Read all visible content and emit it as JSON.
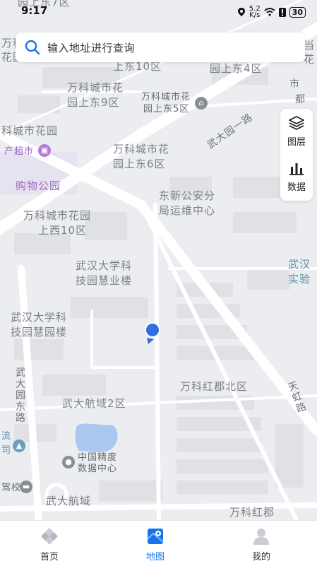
{
  "status_bar": {
    "time": "9:17",
    "speed_value": "5.2",
    "speed_unit": "K/s",
    "battery": "30"
  },
  "search": {
    "placeholder": "输入地址进行查询"
  },
  "side_panel": {
    "layers_label": "图层",
    "data_label": "数据"
  },
  "map": {
    "labels": {
      "top_left_partial": "园上东7区",
      "top_right_partial": "园上东4区",
      "left_edge_partial": "万科",
      "left_edge_partial2": "花园",
      "upper_mid": "上东10区",
      "right_edge_partial": "当",
      "right_edge_partial2": "花",
      "vanke9_line1": "万科城市花",
      "vanke9_line2": "园上东9区",
      "vanke5_line1": "万科城市花",
      "vanke5_line2": "园上东5区",
      "road_top_right": "武大园一路",
      "road_top_right2": "都",
      "road_top_right3": "市",
      "vanke_garden": "科城市花园",
      "supermarket": "产超市",
      "vanke6_line1": "万科城市花",
      "vanke6_line2": "园上东6区",
      "shopping_park": "购物公园",
      "police_line1": "东新公安分",
      "police_line2": "局运维中心",
      "vanke10w_line1": "万科城市花园",
      "vanke10w_line2": "上西10区",
      "whu_sci_line1": "武汉大学科",
      "whu_sci_line2": "技园慧业楼",
      "wuhan_lab_line1": "武汉",
      "wuhan_lab_line2": "实验",
      "whu_garden_line1": "武汉大学科",
      "whu_garden_line2": "技园慧园楼",
      "vanke_red_north": "万科红郡北区",
      "road_left": "武大园东路",
      "road_right": "天虹路",
      "wuda_aero2": "武大航域2区",
      "data_center_line1": "中国精度",
      "data_center_line2": "数据中心",
      "left_flow": "流",
      "left_si": "司",
      "left_school": "驾校",
      "wuda_aero": "武大航域",
      "vanke_red": "万科红郡"
    }
  },
  "nav": {
    "home": "首页",
    "map": "地图",
    "mine": "我的"
  },
  "colors": {
    "accent": "#1a73e8",
    "location_dot": "#2f6fe0",
    "water": "#a9c8ef"
  }
}
